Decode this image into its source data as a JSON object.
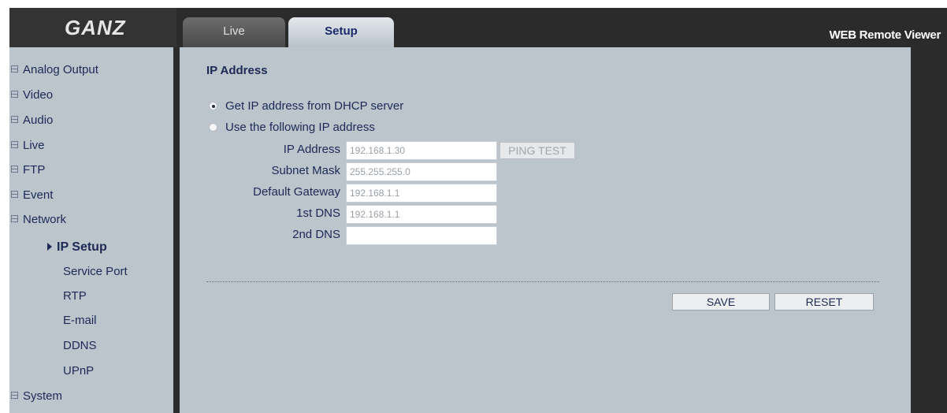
{
  "header": {
    "logo_text": "GANZ",
    "title": "WEB Remote Viewer",
    "tabs": [
      {
        "label": "Live",
        "active": false
      },
      {
        "label": "Setup",
        "active": true
      }
    ]
  },
  "sidebar": {
    "items": [
      {
        "label": "Analog Output"
      },
      {
        "label": "Video"
      },
      {
        "label": "Audio"
      },
      {
        "label": "Live"
      },
      {
        "label": "FTP"
      },
      {
        "label": "Event"
      },
      {
        "label": "Network"
      }
    ],
    "network_sub": [
      {
        "label": "IP Setup",
        "active": true
      },
      {
        "label": "Service Port"
      },
      {
        "label": "RTP"
      },
      {
        "label": "E-mail"
      },
      {
        "label": "DDNS"
      },
      {
        "label": "UPnP"
      }
    ],
    "system_label": "System"
  },
  "main": {
    "section_title": "IP Address",
    "radio_dhcp": {
      "label": "Get IP address from DHCP server",
      "checked": true
    },
    "radio_static": {
      "label": "Use the following IP address",
      "checked": false
    },
    "fields": [
      {
        "label": "IP Address",
        "value": "192.168.1.30"
      },
      {
        "label": "Subnet Mask",
        "value": "255.255.255.0"
      },
      {
        "label": "Default Gateway",
        "value": "192.168.1.1"
      },
      {
        "label": "1st DNS",
        "value": "192.168.1.1"
      },
      {
        "label": "2nd DNS",
        "value": ""
      }
    ],
    "ping_label": "PING TEST",
    "save_label": "SAVE",
    "reset_label": "RESET"
  },
  "colors": {
    "panel": "#bcc4cc",
    "frame": "#2b2b2b",
    "text": "#1c2a55"
  }
}
